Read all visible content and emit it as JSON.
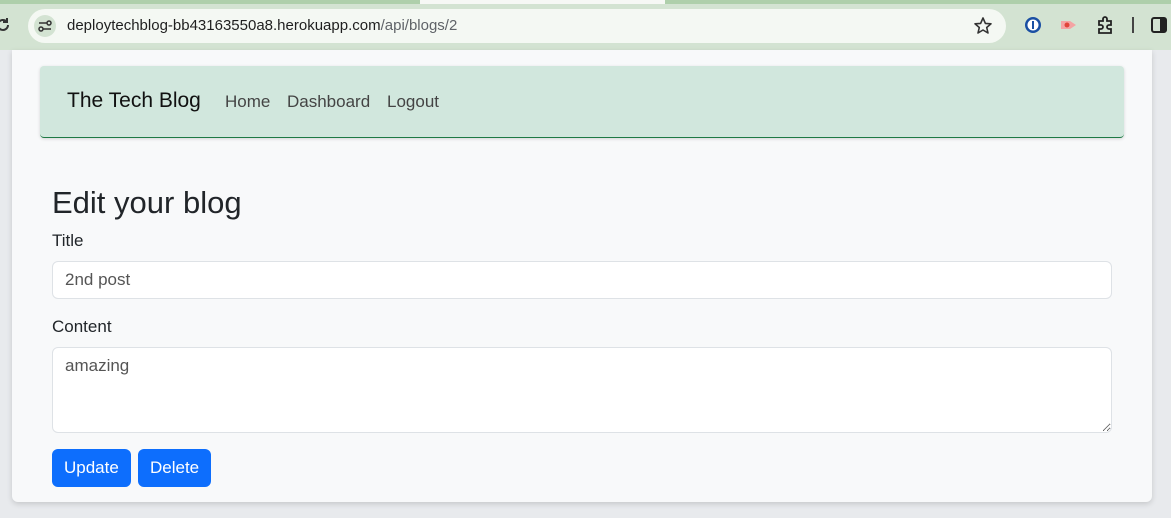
{
  "browser": {
    "url_host": "deploytechblog-bb43163550a8.herokuapp.com",
    "url_path": "/api/blogs/2",
    "icons": [
      "reload-icon",
      "site-info-icon",
      "star-icon",
      "password-manager-icon",
      "extension-record-icon",
      "extensions-icon",
      "side-panel-icon"
    ]
  },
  "navbar": {
    "brand": "The Tech Blog",
    "links": [
      "Home",
      "Dashboard",
      "Logout"
    ]
  },
  "form": {
    "heading": "Edit your blog",
    "title_label": "Title",
    "title_value": "2nd post",
    "content_label": "Content",
    "content_value": "amazing",
    "update_label": "Update",
    "delete_label": "Delete"
  },
  "colors": {
    "navbar_bg": "#d1e7dd",
    "primary_button": "#0d6efd",
    "chrome_bg": "#d3e3d2"
  }
}
